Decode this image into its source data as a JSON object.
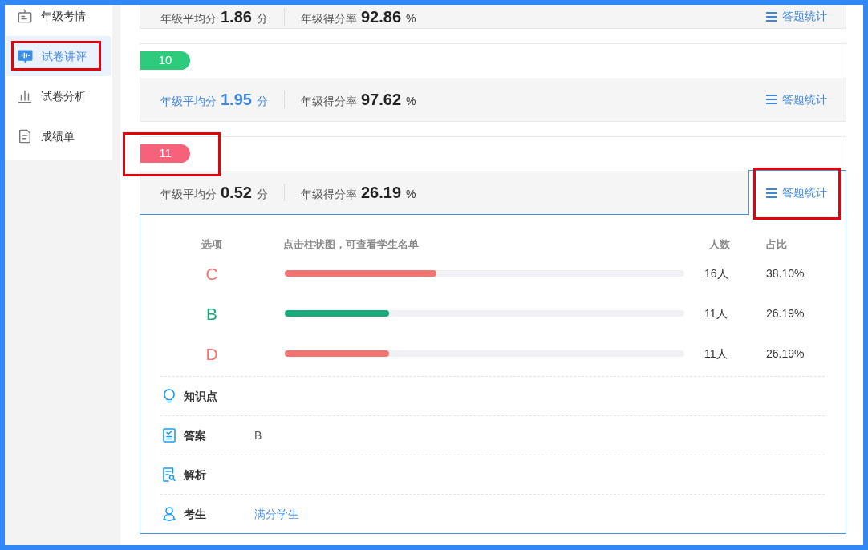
{
  "sidebar": {
    "items": [
      {
        "label": "年级考情",
        "selected": false,
        "annotated": false
      },
      {
        "label": "试卷讲评",
        "selected": true,
        "annotated": true
      },
      {
        "label": "试卷分析",
        "selected": false,
        "annotated": false
      },
      {
        "label": "成绩单",
        "selected": false,
        "annotated": false
      }
    ]
  },
  "questions": [
    {
      "avg_label": "年级平均分",
      "avg": "1.86",
      "avg_unit": "分",
      "avg_highlighted": false,
      "rate_label": "年级得分率",
      "rate": "92.86",
      "rate_unit": "%",
      "stats_button": "答题统计",
      "stats_open": false,
      "stats_annotated": false
    },
    {
      "number": "10",
      "color": "#2ecb7c",
      "badge_annotated": false,
      "avg_label": "年级平均分",
      "avg": "1.95",
      "avg_unit": "分",
      "avg_highlighted": true,
      "rate_label": "年级得分率",
      "rate": "97.62",
      "rate_unit": "%",
      "stats_button": "答题统计",
      "stats_open": false,
      "stats_annotated": false
    },
    {
      "number": "11",
      "color": "#f5627a",
      "badge_annotated": true,
      "avg_label": "年级平均分",
      "avg": "0.52",
      "avg_unit": "分",
      "avg_highlighted": false,
      "rate_label": "年级得分率",
      "rate": "26.19",
      "rate_unit": "%",
      "stats_button": "答题统计",
      "stats_open": true,
      "stats_annotated": true,
      "panel": {
        "columns": [
          "选项",
          "点击柱状图，可查看学生名单",
          "人数",
          "占比"
        ],
        "options": [
          {
            "letter": "C",
            "correct": false,
            "level": 0.38,
            "count": "16人",
            "share": "38.10%"
          },
          {
            "letter": "B",
            "correct": true,
            "level": 0.262,
            "count": "11人",
            "share": "26.19%"
          },
          {
            "letter": "D",
            "correct": false,
            "level": 0.262,
            "count": "11人",
            "share": "26.19%"
          }
        ],
        "details": [
          {
            "kind": "blank",
            "label": "知识点"
          },
          {
            "kind": "text",
            "label": "答案",
            "value": "B"
          },
          {
            "kind": "blank",
            "label": "解析"
          },
          {
            "kind": "link",
            "label": "考生",
            "value": "满分学生"
          }
        ]
      }
    }
  ]
}
